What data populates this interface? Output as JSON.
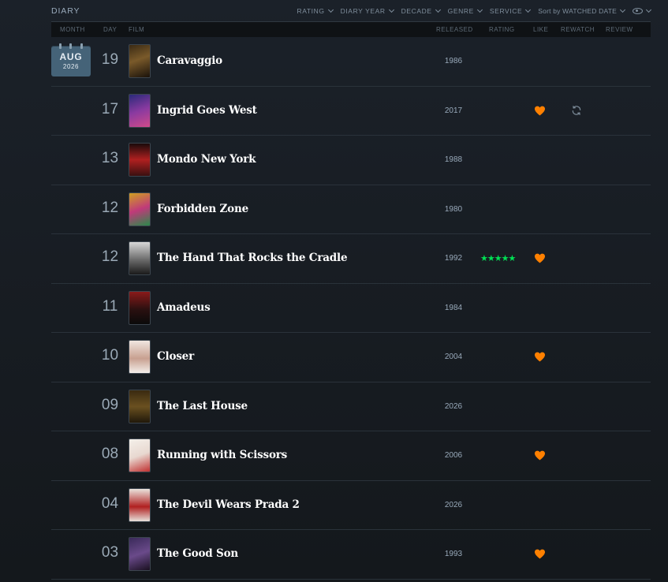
{
  "header": {
    "title": "DIARY",
    "filters": [
      {
        "label": "RATING"
      },
      {
        "label": "DIARY YEAR"
      },
      {
        "label": "DECADE"
      },
      {
        "label": "GENRE"
      },
      {
        "label": "SERVICE"
      },
      {
        "label": "Sort by WATCHED DATE"
      }
    ]
  },
  "columns": {
    "month": "MONTH",
    "day": "DAY",
    "film": "FILM",
    "released": "RELEASED",
    "rating": "RATING",
    "like": "LIKE",
    "rewatch": "REWATCH",
    "review": "REVIEW"
  },
  "calendar": {
    "month": "AUG",
    "year": "2026"
  },
  "colors": {
    "accent_star": "#00e054",
    "accent_heart": "#ff8000",
    "calendar_bg": "#456378"
  },
  "entries": [
    {
      "day": "19",
      "title": "Caravaggio",
      "year": "1986",
      "rating": "",
      "liked": false,
      "rewatch": false
    },
    {
      "day": "17",
      "title": "Ingrid Goes West",
      "year": "2017",
      "rating": "",
      "liked": true,
      "rewatch": true
    },
    {
      "day": "13",
      "title": "Mondo New York",
      "year": "1988",
      "rating": "",
      "liked": false,
      "rewatch": false
    },
    {
      "day": "12",
      "title": "Forbidden Zone",
      "year": "1980",
      "rating": "",
      "liked": false,
      "rewatch": false
    },
    {
      "day": "12",
      "title": "The Hand That Rocks the Cradle",
      "year": "1992",
      "rating": "★★★★★",
      "liked": true,
      "rewatch": false
    },
    {
      "day": "11",
      "title": "Amadeus",
      "year": "1984",
      "rating": "",
      "liked": false,
      "rewatch": false
    },
    {
      "day": "10",
      "title": "Closer",
      "year": "2004",
      "rating": "",
      "liked": true,
      "rewatch": false
    },
    {
      "day": "09",
      "title": "The Last House",
      "year": "2026",
      "rating": "",
      "liked": false,
      "rewatch": false
    },
    {
      "day": "08",
      "title": "Running with Scissors",
      "year": "2006",
      "rating": "",
      "liked": true,
      "rewatch": false
    },
    {
      "day": "04",
      "title": "The Devil Wears Prada 2",
      "year": "2026",
      "rating": "",
      "liked": false,
      "rewatch": false
    },
    {
      "day": "03",
      "title": "The Good Son",
      "year": "1993",
      "rating": "",
      "liked": true,
      "rewatch": false
    }
  ]
}
